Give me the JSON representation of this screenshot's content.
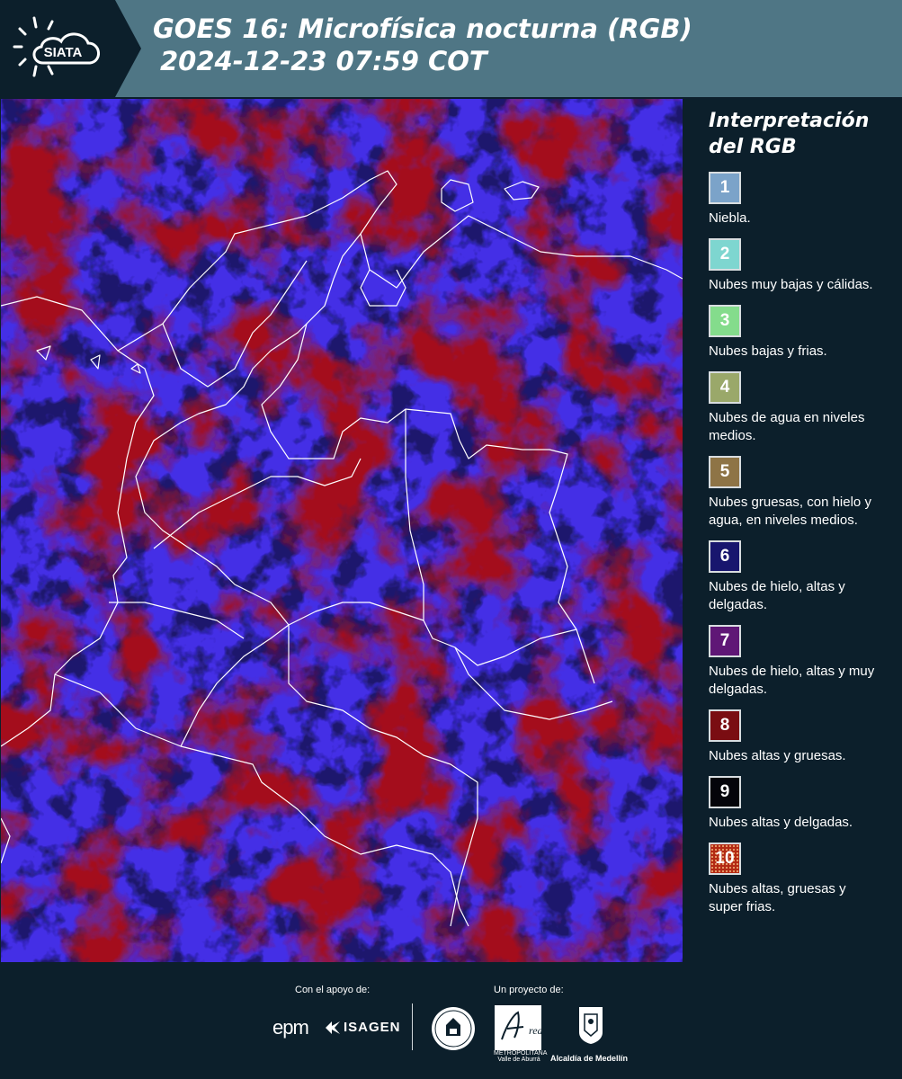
{
  "header": {
    "logo_text": "SIATA",
    "title_line1": "GOES 16: Microfísica nocturna (RGB)",
    "title_line2": "2024-12-23 07:59 COT"
  },
  "legend": {
    "title_line1": "Interpretación",
    "title_line2": "del RGB",
    "items": [
      {
        "number": "1",
        "label": "Niebla.",
        "color": "#7ba3c9"
      },
      {
        "number": "2",
        "label": "Nubes muy bajas y cálidas.",
        "color": "#7ed6d0"
      },
      {
        "number": "3",
        "label": "Nubes bajas y frias.",
        "color": "#84dc8c"
      },
      {
        "number": "4",
        "label": "Nubes de agua en niveles medios.",
        "color": "#9aa86a"
      },
      {
        "number": "5",
        "label": "Nubes gruesas, con hielo y agua, en niveles medios.",
        "color": "#8e7446"
      },
      {
        "number": "6",
        "label": "Nubes de hielo, altas y delgadas.",
        "color": "#18166e"
      },
      {
        "number": "7",
        "label": "Nubes de hielo, altas y muy delgadas.",
        "color": "#5f1776"
      },
      {
        "number": "8",
        "label": "Nubes altas y gruesas.",
        "color": "#7a0d12"
      },
      {
        "number": "9",
        "label": "Nubes altas y delgadas.",
        "color": "#04040a"
      },
      {
        "number": "10",
        "label": "Nubes altas, gruesas y super frias.",
        "color": "#b32a14"
      }
    ]
  },
  "footer": {
    "support_label": "Con el apoyo de:",
    "project_label": "Un proyecto de:",
    "epm": "epm",
    "isagen": "ISAGEN",
    "amva": "METROPOLITANA Valle de Aburrá",
    "medellin": "Alcaldía de Medellín"
  },
  "colors": {
    "background": "#0c1f2b",
    "header_band": "#4f7685"
  }
}
